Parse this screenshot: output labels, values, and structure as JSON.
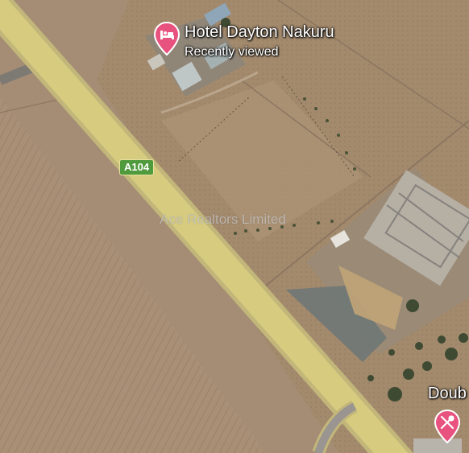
{
  "map": {
    "view": "satellite",
    "road": {
      "label": "A104",
      "color": "#d6cb7e"
    },
    "watermark": "Ace Realtors Limited"
  },
  "places": [
    {
      "name": "Hotel Dayton Nakuru",
      "subtitle": "Recently viewed",
      "icon": "hotel-bed-icon",
      "pin_color": "#e8527f"
    },
    {
      "name": "Doub",
      "icon": "restaurant-icon",
      "pin_color": "#e8527f"
    }
  ]
}
